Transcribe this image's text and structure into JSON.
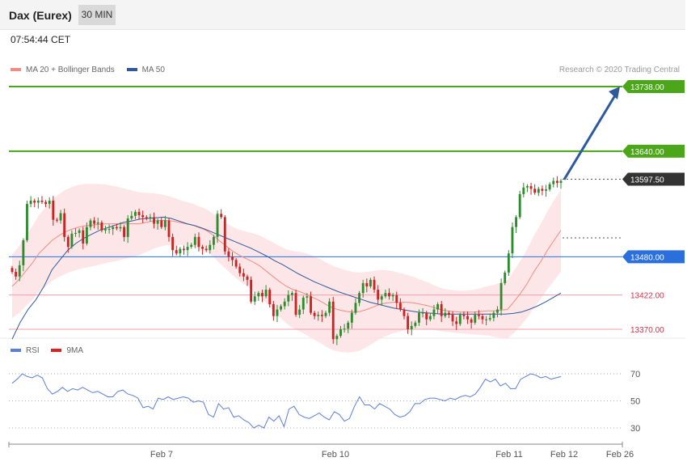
{
  "header": {
    "instrument": "Dax (Eurex)",
    "timeframe": "30 MIN"
  },
  "time": "07:54:44 CET",
  "legend": [
    {
      "label": "MA 20 + Bollinger Bands",
      "color": "#f28b82"
    },
    {
      "label": "MA 50",
      "color": "#2e5a9c"
    }
  ],
  "credit": "Research © 2020 Trading Central",
  "rsi_legend": [
    {
      "label": "RSI",
      "color": "#5b7fd6"
    },
    {
      "label": "9MA",
      "color": "#e02020"
    }
  ],
  "colors": {
    "up": "#2e8b2e",
    "down": "#cc2222",
    "resistance": "#4ca619",
    "pivot": "#2a6fdb",
    "support": "#f0a0a8",
    "arrow": "#2e5a9c"
  },
  "chart_data": [
    {
      "type": "candlestick",
      "title": "Dax (Eurex)",
      "x_ticks": [
        "Feb 7",
        "Feb 10",
        "Feb 11",
        "Feb 12",
        "Feb 26"
      ],
      "ylim": [
        13350,
        13760
      ],
      "levels": [
        {
          "value": 13738.0,
          "label": "13738.00",
          "kind": "resistance"
        },
        {
          "value": 13640.0,
          "label": "13640.00",
          "kind": "resistance"
        },
        {
          "value": 13597.5,
          "label": "13597.50",
          "kind": "last"
        },
        {
          "value": 13480.0,
          "label": "13480.00",
          "kind": "pivot"
        },
        {
          "value": 13422.0,
          "label": "13422.00",
          "kind": "support"
        },
        {
          "value": 13370.0,
          "label": "13370.00",
          "kind": "support"
        }
      ],
      "close": [
        13457,
        13450,
        13467,
        13505,
        13560,
        13565,
        13562,
        13565,
        13563,
        13560,
        13565,
        13536,
        13535,
        13546,
        13510,
        13495,
        13515,
        13516,
        13520,
        13500,
        13525,
        13535,
        13530,
        13532,
        13520,
        13522,
        13522,
        13525,
        13523,
        13525,
        13510,
        13538,
        13542,
        13548,
        13543,
        13540,
        13538,
        13540,
        13530,
        13535,
        13525,
        13535,
        13510,
        13490,
        13485,
        13492,
        13490,
        13495,
        13498,
        13510,
        13495,
        13492,
        13490,
        13498,
        13510,
        13545,
        13540,
        13488,
        13480,
        13475,
        13465,
        13455,
        13450,
        13445,
        13412,
        13420,
        13425,
        13420,
        13430,
        13408,
        13390,
        13400,
        13405,
        13412,
        13422,
        13425,
        13392,
        13400,
        13418,
        13420,
        13395,
        13390,
        13392,
        13390,
        13395,
        13412,
        13355,
        13360,
        13370,
        13371,
        13380,
        13395,
        13410,
        13425,
        13440,
        13435,
        13445,
        13430,
        13415,
        13420,
        13425,
        13420,
        13422,
        13410,
        13400,
        13390,
        13370,
        13375,
        13380,
        13395,
        13395,
        13385,
        13390,
        13400,
        13408,
        13390,
        13395,
        13392,
        13382,
        13378,
        13392,
        13390,
        13385,
        13380,
        13392,
        13390,
        13385,
        13385,
        13387,
        13395,
        13400,
        13440,
        13456,
        13485,
        13525,
        13540,
        13575,
        13585,
        13587,
        13583,
        13577,
        13583,
        13580,
        13582,
        13590,
        13595,
        13592,
        13595
      ],
      "ma20": [
        13435,
        13445,
        13458,
        13470,
        13485,
        13495,
        13505,
        13512,
        13518,
        13522,
        13525,
        13527,
        13528,
        13529,
        13530,
        13530,
        13530,
        13530,
        13530,
        13530,
        13532,
        13534,
        13535,
        13535,
        13534,
        13532,
        13530,
        13528,
        13524,
        13520,
        13513,
        13504,
        13496,
        13488,
        13482,
        13477,
        13472,
        13466,
        13458,
        13450,
        13442,
        13435,
        13430,
        13427,
        13423,
        13418,
        13413,
        13407,
        13402,
        13399,
        13397,
        13396,
        13397,
        13400,
        13404,
        13408,
        13410,
        13411,
        13411,
        13411,
        13410,
        13408,
        13406,
        13403,
        13400,
        13398,
        13397,
        13396,
        13396,
        13396,
        13397,
        13398,
        13398,
        13399,
        13400,
        13412,
        13425,
        13440,
        13458,
        13473,
        13490,
        13505,
        13520
      ],
      "ma50": [
        13355,
        13380,
        13400,
        13415,
        13435,
        13460,
        13475,
        13490,
        13500,
        13508,
        13514,
        13520,
        13524,
        13528,
        13532,
        13534,
        13537,
        13538,
        13539,
        13540,
        13538,
        13534,
        13530,
        13527,
        13523,
        13518,
        13513,
        13508,
        13503,
        13498,
        13493,
        13487,
        13481,
        13474,
        13468,
        13461,
        13454,
        13448,
        13442,
        13437,
        13432,
        13427,
        13423,
        13419,
        13415,
        13411,
        13408,
        13405,
        13402,
        13400,
        13398,
        13396,
        13395,
        13394,
        13393,
        13393,
        13393,
        13393,
        13393,
        13393,
        13393,
        13393,
        13393,
        13394,
        13396,
        13400,
        13405,
        13411,
        13418,
        13425
      ],
      "rsi": [
        63,
        66,
        70,
        68,
        67,
        69,
        67,
        59,
        55,
        57,
        60,
        57,
        59,
        58,
        60,
        58,
        56,
        57,
        55,
        53,
        53,
        57,
        58,
        55,
        54,
        52,
        45,
        46,
        44,
        52,
        51,
        53,
        51,
        52,
        53,
        52,
        49,
        50,
        49,
        40,
        38,
        48,
        44,
        45,
        38,
        39,
        36,
        34,
        30,
        32,
        30,
        38,
        35,
        39,
        31,
        44,
        46,
        40,
        38,
        37,
        39,
        41,
        38,
        36,
        42,
        40,
        35,
        37,
        46,
        53,
        47,
        47,
        44,
        48,
        46,
        44,
        40,
        38,
        39,
        42,
        48,
        48,
        51,
        52,
        52,
        51,
        50,
        52,
        51,
        53,
        54,
        53,
        55,
        60,
        66,
        64,
        66,
        61,
        63,
        59,
        59,
        66,
        68,
        70,
        69,
        67,
        68,
        66,
        67,
        68
      ]
    }
  ]
}
